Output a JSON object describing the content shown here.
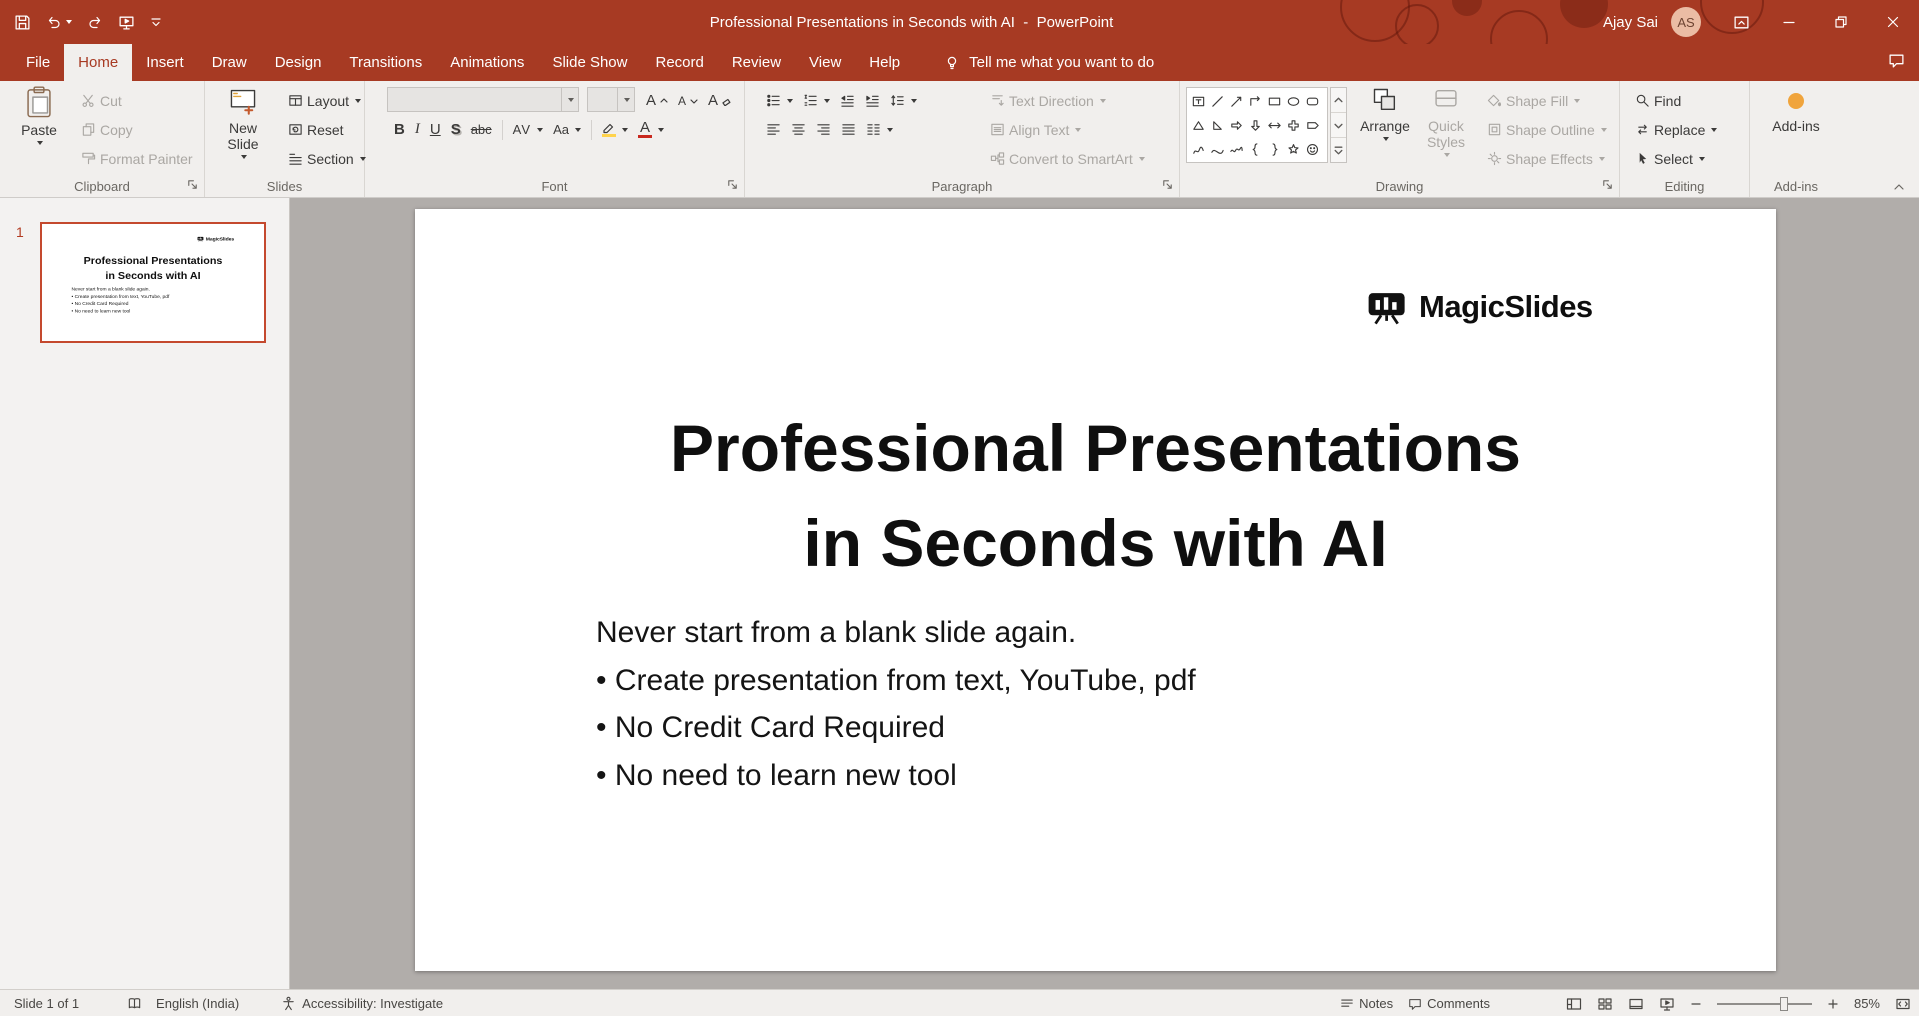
{
  "titlebar": {
    "title": "Professional Presentations in Seconds with AI  -  PowerPoint",
    "user_name": "Ajay Sai",
    "user_initials": "AS"
  },
  "ribbon": {
    "tabs": [
      "File",
      "Home",
      "Insert",
      "Draw",
      "Design",
      "Transitions",
      "Animations",
      "Slide Show",
      "Record",
      "Review",
      "View",
      "Help"
    ],
    "active_tab": "Home",
    "tell_me": "Tell me what you want to do",
    "clipboard": {
      "label": "Clipboard",
      "paste": "Paste",
      "cut": "Cut",
      "copy": "Copy",
      "format_painter": "Format Painter"
    },
    "slides": {
      "label": "Slides",
      "new_slide": "New Slide",
      "layout": "Layout",
      "reset": "Reset",
      "section": "Section"
    },
    "font": {
      "label": "Font",
      "name_value": "",
      "size_value": "",
      "bold": "B",
      "italic": "I",
      "underline": "U",
      "shadow": "S",
      "strikethrough": "abc",
      "char_spacing": "AV",
      "change_case": "Aa",
      "grow": "A",
      "shrink": "A",
      "clear": "A",
      "font_color": "A"
    },
    "paragraph": {
      "label": "Paragraph",
      "text_direction": "Text Direction",
      "align_text": "Align Text",
      "convert_smartart": "Convert to SmartArt"
    },
    "drawing": {
      "label": "Drawing",
      "arrange": "Arrange",
      "quick_styles": "Quick Styles",
      "shape_fill": "Shape Fill",
      "shape_outline": "Shape Outline",
      "shape_effects": "Shape Effects"
    },
    "editing": {
      "label": "Editing",
      "find": "Find",
      "replace": "Replace",
      "select": "Select"
    },
    "addins": {
      "label": "Add-ins",
      "button": "Add-ins"
    }
  },
  "panel": {
    "slide_number": "1"
  },
  "slide": {
    "logo_text": "MagicSlides",
    "title_line1": "Professional Presentations",
    "title_line2": "in Seconds with AI",
    "body_lines": [
      "Never start from a blank slide again.",
      "• Create presentation from text, YouTube, pdf",
      "• No Credit Card Required",
      "• No need to learn new tool"
    ]
  },
  "statusbar": {
    "slide_indicator": "Slide 1 of 1",
    "language": "English (India)",
    "accessibility": "Accessibility: Investigate",
    "notes": "Notes",
    "comments": "Comments",
    "zoom": "85%"
  },
  "colors": {
    "titlebar_red": "#A73A23",
    "accent_red": "#C4492E",
    "addin_dot": "#F0A43C",
    "font_color_bar": "#C8281E",
    "highlight_bar": "#FFD34D"
  }
}
